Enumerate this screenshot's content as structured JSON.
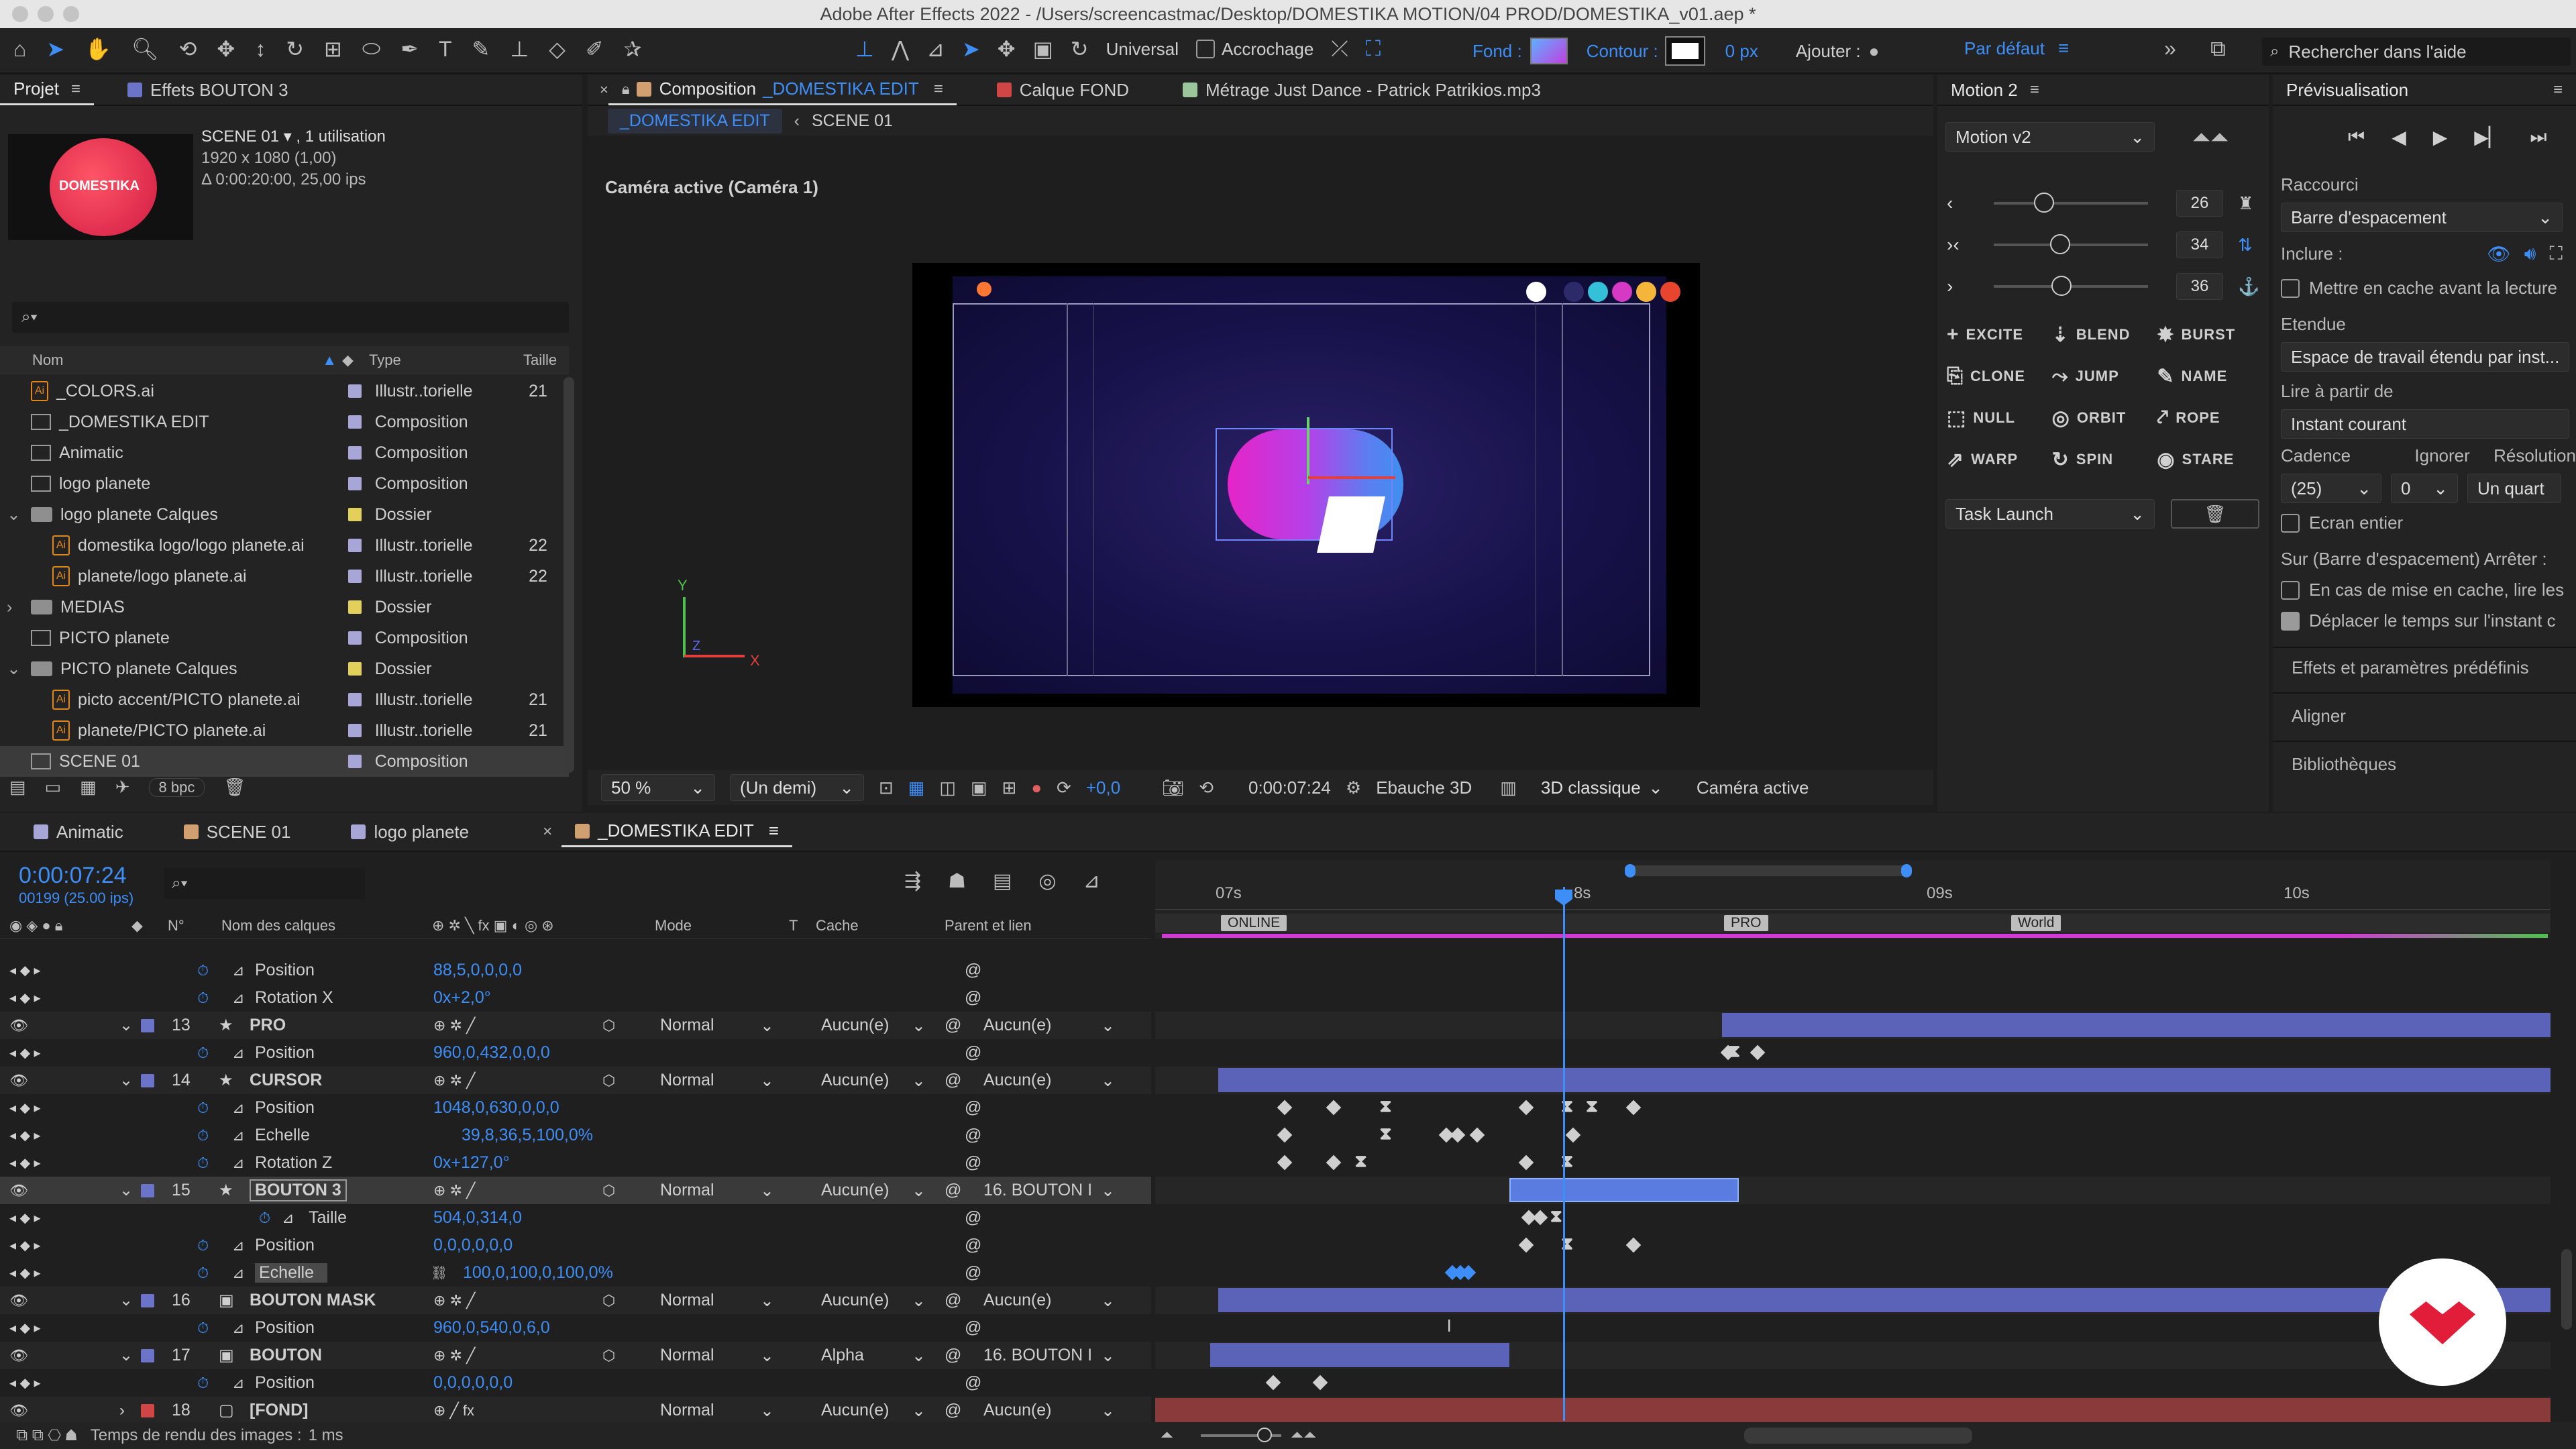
{
  "titlebar": {
    "title": "Adobe After Effects 2022 - /Users/screencastmac/Desktop/DOMESTIKA MOTION/04 PROD/DOMESTIKA_v01.aep *"
  },
  "toolbar": {
    "universal": "Universal",
    "snapping": "Accrochage",
    "fill": "Fond :",
    "stroke": "Contour :",
    "stroke_px": "0 px",
    "add": "Ajouter :",
    "workspace": "Par défaut",
    "search_placeholder": "Rechercher dans l'aide"
  },
  "project": {
    "tab": "Projet",
    "effects_tab": "Effets BOUTON 3",
    "selected_name": "SCENE 01 ▾ , 1 utilisation",
    "selected_res": "1920 x 1080 (1,00)",
    "selected_dur": "Δ 0:00:20:00, 25,00 ips",
    "thumb_logo": "DOMESTIKA",
    "col_name": "Nom",
    "col_type": "Type",
    "col_size": "Taille",
    "bpc": "8 bpc",
    "items": [
      {
        "name": "_COLORS.ai",
        "type": "Illustr..torielle",
        "size": "21",
        "kind": "file",
        "color": "#a7a6d6",
        "indent": 0,
        "tw": ""
      },
      {
        "name": "_DOMESTIKA EDIT",
        "type": "Composition",
        "size": "",
        "kind": "comp",
        "color": "#a7a6d6",
        "indent": 0,
        "tw": ""
      },
      {
        "name": "Animatic",
        "type": "Composition",
        "size": "",
        "kind": "comp",
        "color": "#a7a6d6",
        "indent": 0,
        "tw": ""
      },
      {
        "name": "logo planete",
        "type": "Composition",
        "size": "",
        "kind": "comp",
        "color": "#a7a6d6",
        "indent": 0,
        "tw": ""
      },
      {
        "name": "logo planete Calques",
        "type": "Dossier",
        "size": "",
        "kind": "folder",
        "color": "#e2d05b",
        "indent": 0,
        "tw": "⌄"
      },
      {
        "name": "domestika logo/logo planete.ai",
        "type": "Illustr..torielle",
        "size": "22",
        "kind": "file",
        "color": "#a7a6d6",
        "indent": 1,
        "tw": ""
      },
      {
        "name": "planete/logo planete.ai",
        "type": "Illustr..torielle",
        "size": "22",
        "kind": "file",
        "color": "#a7a6d6",
        "indent": 1,
        "tw": ""
      },
      {
        "name": "MEDIAS",
        "type": "Dossier",
        "size": "",
        "kind": "folder",
        "color": "#e2d05b",
        "indent": 0,
        "tw": "›"
      },
      {
        "name": "PICTO planete",
        "type": "Composition",
        "size": "",
        "kind": "comp",
        "color": "#a7a6d6",
        "indent": 0,
        "tw": ""
      },
      {
        "name": "PICTO planete Calques",
        "type": "Dossier",
        "size": "",
        "kind": "folder",
        "color": "#e2d05b",
        "indent": 0,
        "tw": "⌄"
      },
      {
        "name": "picto accent/PICTO planete.ai",
        "type": "Illustr..torielle",
        "size": "21",
        "kind": "file",
        "color": "#a7a6d6",
        "indent": 1,
        "tw": ""
      },
      {
        "name": "planete/PICTO planete.ai",
        "type": "Illustr..torielle",
        "size": "21",
        "kind": "file",
        "color": "#a7a6d6",
        "indent": 1,
        "tw": ""
      },
      {
        "name": "SCENE 01",
        "type": "Composition",
        "size": "",
        "kind": "comp",
        "color": "#a7a6d6",
        "indent": 0,
        "tw": "",
        "selected": true
      }
    ]
  },
  "comp": {
    "tab_prefix": "Composition",
    "tab_name": "_DOMESTIKA EDIT",
    "layer_tab": "Calque FOND",
    "footage_tab": "Métrage Just Dance - Patrick Patrikios.mp3",
    "crumb1": "_DOMESTIKA EDIT",
    "crumb2": "SCENE 01",
    "camera_label": "Caméra active (Caméra 1)",
    "zoom": "50 %",
    "resolution": "(Un demi)",
    "exposure": "+0,0",
    "timecode": "0:00:07:24",
    "draft": "Ebauche 3D",
    "renderer": "3D classique",
    "view": "Caméra active",
    "axis_y": "Y",
    "axis_x": "X",
    "axis_z": "Z"
  },
  "motion": {
    "tab": "Motion 2",
    "preset": "Motion v2",
    "slider_values": [
      "26",
      "34",
      "36"
    ],
    "sliders": [
      0.3,
      0.42,
      0.43
    ],
    "buttons": [
      {
        "glyph": "+",
        "label": "EXCITE"
      },
      {
        "glyph": "⇣",
        "label": "BLEND"
      },
      {
        "glyph": "✸",
        "label": "BURST"
      },
      {
        "glyph": "⎘",
        "label": "CLONE"
      },
      {
        "glyph": "⤳",
        "label": "JUMP"
      },
      {
        "glyph": "✎",
        "label": "NAME"
      },
      {
        "glyph": "⬚",
        "label": "NULL"
      },
      {
        "glyph": "◎",
        "label": "ORBIT"
      },
      {
        "glyph": "⤤",
        "label": "ROPE"
      },
      {
        "glyph": "⇗",
        "label": "WARP"
      },
      {
        "glyph": "↻",
        "label": "SPIN"
      },
      {
        "glyph": "◉",
        "label": "STARE"
      }
    ],
    "task": "Task Launch"
  },
  "preview": {
    "tab": "Prévisualisation",
    "shortcut_label": "Raccourci",
    "shortcut": "Barre d'espacement",
    "include": "Inclure :",
    "cache_before": "Mettre en cache avant la lecture",
    "range_label": "Etendue",
    "range": "Espace de travail étendu par inst...",
    "play_from_label": "Lire à partir de",
    "play_from": "Instant courant",
    "fps_label": "Cadence",
    "skip_label": "Ignorer",
    "res_label": "Résolution",
    "fps": "(25)",
    "skip": "0",
    "res": "Un quart",
    "fullscreen": "Ecran entier",
    "stop_label": "Sur (Barre d'espacement) Arrêter :",
    "cache_stop": "En cas de mise en cache, lire les",
    "move_time": "Déplacer le temps sur l'instant c",
    "effects_presets": "Effets et paramètres prédéfinis",
    "align": "Aligner",
    "libraries": "Bibliothèques"
  },
  "timeline": {
    "tabs": [
      {
        "name": "Animatic",
        "color": "#a7a6d6"
      },
      {
        "name": "SCENE 01",
        "color": "#d0a070"
      },
      {
        "name": "logo planete",
        "color": "#a7a6d6"
      },
      {
        "name": "_DOMESTIKA EDIT",
        "color": "#d0a070"
      }
    ],
    "timecode": "0:00:07:24",
    "frames": "00199 (25.00 ips)",
    "col_num": "N°",
    "col_name": "Nom des calques",
    "col_mode": "Mode",
    "col_t": "T",
    "col_cache": "Cache",
    "col_parent": "Parent et lien",
    "ruler": [
      "07s",
      "8s",
      "09s",
      "10s"
    ],
    "markers": [
      "ONLINE",
      "PRO",
      "World"
    ],
    "status": "Temps de rendu des images :",
    "render_time": "1 ms",
    "rows": [
      {
        "kind": "prop",
        "name": "Position",
        "value": "88,5,0,0,0,0"
      },
      {
        "kind": "prop",
        "name": "Rotation X",
        "value": "0x+2,0°"
      },
      {
        "kind": "layer",
        "num": "13",
        "name": "PRO",
        "color": "#6c74c9",
        "mode": "Normal",
        "cache": "Aucun(e)",
        "parent": "Aucun(e)"
      },
      {
        "kind": "prop",
        "name": "Position",
        "value": "960,0,432,0,0,0"
      },
      {
        "kind": "layer",
        "num": "14",
        "name": "CURSOR",
        "color": "#6c74c9",
        "mode": "Normal",
        "cache": "Aucun(e)",
        "parent": "Aucun(e)"
      },
      {
        "kind": "prop",
        "name": "Position",
        "value": "1048,0,630,0,0,0"
      },
      {
        "kind": "prop",
        "name": "Echelle",
        "value": "39,8,36,5,100,0%"
      },
      {
        "kind": "prop",
        "name": "Rotation Z",
        "value": "0x+127,0°"
      },
      {
        "kind": "layer",
        "num": "15",
        "name": "BOUTON 3",
        "color": "#6c74c9",
        "mode": "Normal",
        "cache": "Aucun(e)",
        "parent": "16. BOUTON I",
        "selected": true
      },
      {
        "kind": "prop",
        "name": "Taille",
        "value": "504,0,314,0",
        "deep": true
      },
      {
        "kind": "prop",
        "name": "Position",
        "value": "0,0,0,0,0,0"
      },
      {
        "kind": "prop",
        "name": "Echelle",
        "value": "100,0,100,0,100,0%",
        "sel": true
      },
      {
        "kind": "layer",
        "num": "16",
        "name": "BOUTON MASK",
        "color": "#6c74c9",
        "mode": "Normal",
        "cache": "Aucun(e)",
        "parent": "Aucun(e)"
      },
      {
        "kind": "prop",
        "name": "Position",
        "value": "960,0,540,0,6,0"
      },
      {
        "kind": "layer",
        "num": "17",
        "name": "BOUTON",
        "color": "#6c74c9",
        "mode": "Normal",
        "cache": "Alpha",
        "parent": "16. BOUTON I"
      },
      {
        "kind": "prop",
        "name": "Position",
        "value": "0,0,0,0,0,0"
      },
      {
        "kind": "layer",
        "num": "18",
        "name": "[FOND]",
        "color": "#d04545",
        "mode": "Normal",
        "cache": "Aucun(e)",
        "parent": "Aucun(e)"
      }
    ]
  }
}
